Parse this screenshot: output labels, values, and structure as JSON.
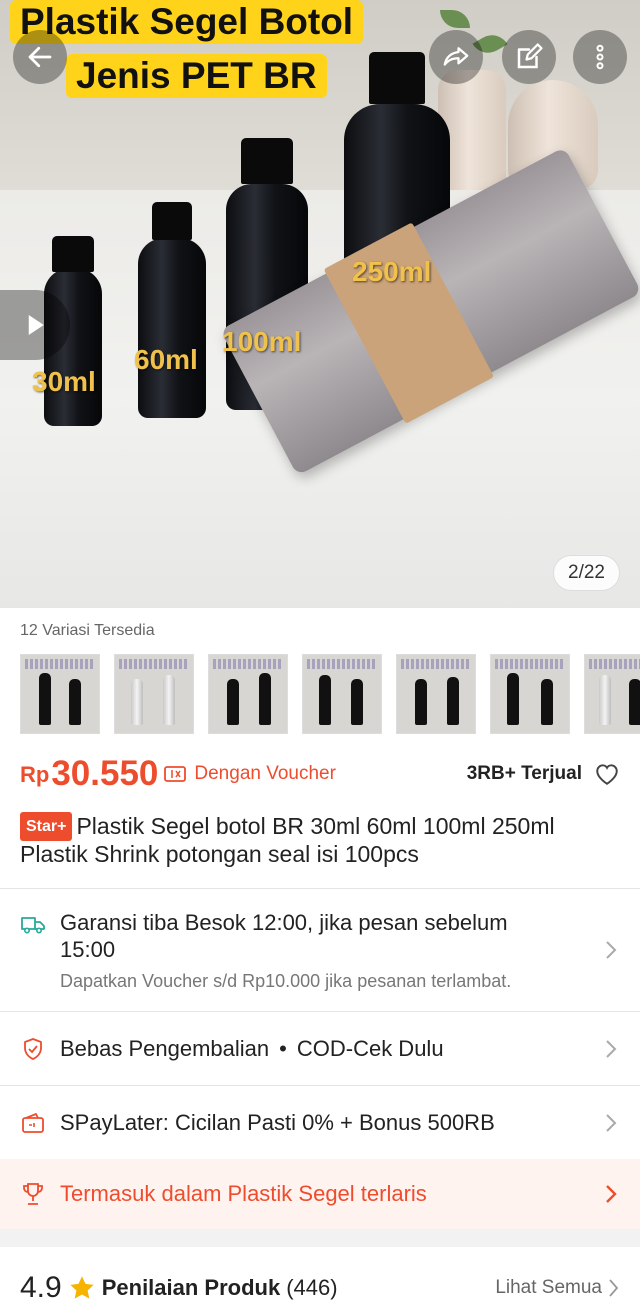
{
  "hero": {
    "title_line1": "Plastik Segel Botol",
    "title_line2": "Jenis PET BR",
    "size_labels": [
      "30ml",
      "60ml",
      "100ml",
      "250ml"
    ],
    "image_counter": "2/22",
    "icons": [
      "back-arrow-icon",
      "share-icon",
      "edit-icon",
      "more-vertical-icon",
      "play-icon"
    ]
  },
  "variations": {
    "label": "12 Variasi Tersedia",
    "thumb_count_visible": 7
  },
  "price": {
    "currency": "Rp",
    "value": "30.550",
    "voucher_text": "Dengan Voucher",
    "sold": "3RB+ Terjual"
  },
  "product": {
    "badge": "Star+",
    "title": "Plastik Segel botol BR 30ml 60ml 100ml 250ml Plastik Shrink potongan seal isi 100pcs"
  },
  "shipping": {
    "line1": "Garansi tiba Besok 12:00, jika pesan sebelum 15:00",
    "line2": "Dapatkan Voucher s/d Rp10.000 jika pesanan terlambat."
  },
  "returns": {
    "label": "Bebas Pengembalian",
    "separator": "•",
    "cod": "COD-Cek Dulu"
  },
  "paylater": {
    "label": "SPayLater: Cicilan Pasti 0% + Bonus 500RB"
  },
  "bestseller": {
    "label": "Termasuk dalam Plastik Segel terlaris"
  },
  "rating": {
    "score": "4.9",
    "label": "Penilaian Produk",
    "count": "(446)",
    "see_all": "Lihat Semua"
  },
  "colors": {
    "accent": "#ee4d2d",
    "highlight": "#ffd31a",
    "star": "#f6b400",
    "teal": "#26aa99"
  }
}
